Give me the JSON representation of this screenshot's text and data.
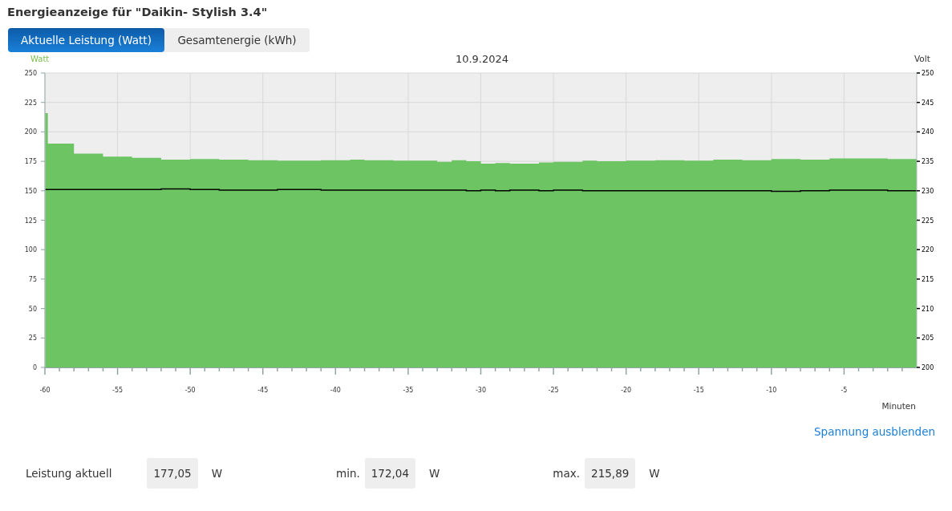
{
  "title": "Energieanzeige für \"Daikin- Stylish 3.4\"",
  "tabs": [
    {
      "label": "Aktuelle Leistung (Watt)",
      "selected": true
    },
    {
      "label": "Gesamtenergie (kWh)",
      "selected": false
    }
  ],
  "chart": {
    "chart_data": {
      "type": "area",
      "title": "10.9.2024",
      "xlabel": "Minuten",
      "ylabel": "Watt",
      "y2label": "Volt",
      "x": [
        -60,
        -59.8,
        -58,
        -56,
        -54,
        -52,
        -50,
        -48,
        -46,
        -44,
        -41,
        -39,
        -38,
        -36,
        -33,
        -32,
        -31,
        -30,
        -29,
        -28,
        -26,
        -25,
        -23,
        -22,
        -20,
        -18,
        -16,
        -14,
        -12,
        -10,
        -8,
        -6,
        -2,
        0
      ],
      "series": [
        {
          "type": "area",
          "color": "#6cc463",
          "values": [
            216,
            190,
            181.5,
            179,
            178,
            176.5,
            177,
            176.5,
            176,
            175.5,
            176,
            176.5,
            176,
            175.5,
            174.5,
            176,
            175,
            173,
            173.5,
            173,
            174,
            174.5,
            175.5,
            175,
            175.5,
            176,
            175.5,
            176.5,
            176,
            177,
            176.5,
            177.5,
            177,
            177
          ]
        },
        {
          "type": "line",
          "color": "#000000",
          "axis": "y2",
          "values": [
            230.2,
            230.2,
            230.2,
            230.2,
            230.2,
            230.3,
            230.2,
            230.1,
            230.1,
            230.2,
            230.1,
            230.1,
            230.1,
            230.1,
            230.1,
            230.1,
            230.0,
            230.1,
            230.0,
            230.1,
            230.0,
            230.1,
            230.0,
            230.0,
            230.0,
            230.0,
            230.0,
            230.0,
            230.0,
            229.9,
            230.0,
            230.1,
            230.0,
            230.0
          ]
        }
      ],
      "grid": true,
      "xlim": [
        -60,
        0
      ],
      "ylim": [
        0,
        250
      ],
      "y2lim": [
        200,
        250
      ],
      "xticks": [
        -60,
        -55,
        -50,
        -45,
        -40,
        -35,
        -30,
        -25,
        -20,
        -15,
        -10,
        -5
      ],
      "yticks": [
        0,
        25,
        50,
        75,
        100,
        125,
        150,
        175,
        200,
        225,
        250
      ],
      "y2ticks": [
        200,
        205,
        210,
        215,
        220,
        225,
        230,
        235,
        240,
        245,
        250
      ]
    }
  },
  "toggle_link": "Spannung ausblenden",
  "stats": [
    {
      "label": "Leistung aktuell",
      "value": "177,05",
      "unit": "W"
    },
    {
      "label": "min.",
      "value": "172,04",
      "unit": "W"
    },
    {
      "label": "max.",
      "value": "215,89",
      "unit": "W"
    }
  ]
}
